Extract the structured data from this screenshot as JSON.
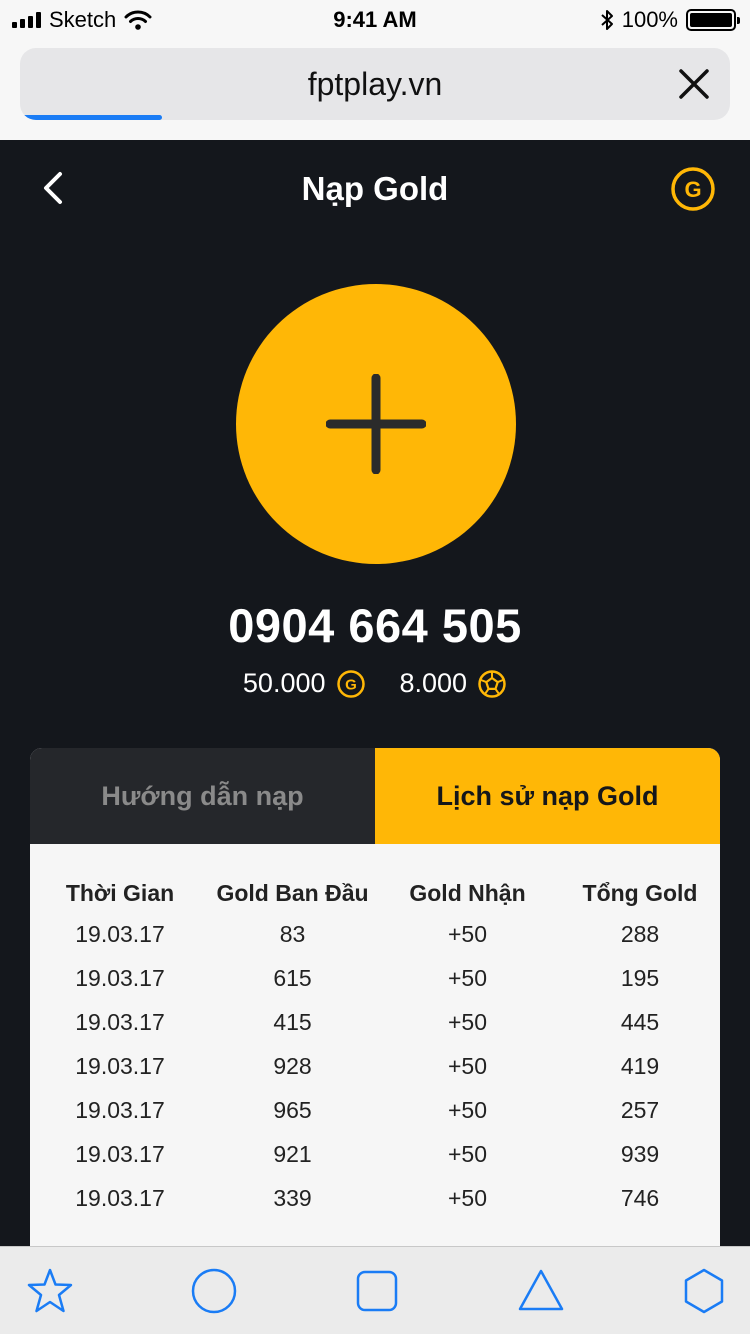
{
  "status_bar": {
    "carrier": "Sketch",
    "time": "9:41 AM",
    "battery": "100%"
  },
  "browser": {
    "url": "fptplay.vn",
    "load_progress": 0.2
  },
  "header": {
    "title": "Nạp Gold"
  },
  "account": {
    "phone": "0904 664 505",
    "gold_balance": "50.000",
    "point_balance": "8.000"
  },
  "tabs": [
    {
      "label": "Hướng dẫn nạp",
      "active": false
    },
    {
      "label": "Lịch sử nạp Gold",
      "active": true
    }
  ],
  "history": {
    "columns": [
      "Thời Gian",
      "Gold Ban Đầu",
      "Gold Nhận",
      "Tổng Gold"
    ],
    "rows": [
      [
        "19.03.17",
        "83",
        "+50",
        "288"
      ],
      [
        "19.03.17",
        "615",
        "+50",
        "195"
      ],
      [
        "19.03.17",
        "415",
        "+50",
        "445"
      ],
      [
        "19.03.17",
        "928",
        "+50",
        "419"
      ],
      [
        "19.03.17",
        "965",
        "+50",
        "257"
      ],
      [
        "19.03.17",
        "921",
        "+50",
        "939"
      ],
      [
        "19.03.17",
        "339",
        "+50",
        "746"
      ]
    ]
  },
  "toolbar": {
    "icons": [
      "star-icon",
      "circle-icon",
      "square-icon",
      "triangle-icon",
      "hexagon-icon"
    ]
  },
  "colors": {
    "accent": "#ffb706",
    "background": "#14171c",
    "link_blue": "#1a7cf5"
  }
}
